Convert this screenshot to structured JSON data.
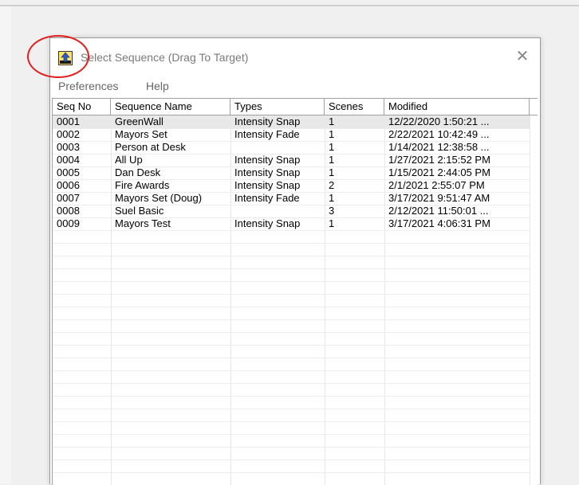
{
  "window": {
    "title": "Select Sequence (Drag To Target)",
    "icon": "sequence-app-icon",
    "close_glyph": "✕"
  },
  "menu": {
    "items": [
      {
        "label": "Preferences"
      },
      {
        "label": "Help"
      }
    ]
  },
  "table": {
    "columns": [
      "Seq No",
      "Sequence Name",
      "Types",
      "Scenes",
      "Modified"
    ],
    "rows": [
      {
        "seq": "0001",
        "name": "GreenWall",
        "type": "Intensity Snap",
        "scenes": "1",
        "modified": "12/22/2020 1:50:21 ..."
      },
      {
        "seq": "0002",
        "name": "Mayors Set",
        "type": "Intensity Fade",
        "scenes": "1",
        "modified": "2/22/2021 10:42:49 ..."
      },
      {
        "seq": "0003",
        "name": "Person at Desk",
        "type": "",
        "scenes": "1",
        "modified": "1/14/2021 12:38:58 ..."
      },
      {
        "seq": "0004",
        "name": "All Up",
        "type": "Intensity Snap",
        "scenes": "1",
        "modified": "1/27/2021 2:15:52 PM"
      },
      {
        "seq": "0005",
        "name": "Dan Desk",
        "type": "Intensity Snap",
        "scenes": "1",
        "modified": "1/15/2021 2:44:05 PM"
      },
      {
        "seq": "0006",
        "name": "Fire Awards",
        "type": "Intensity Snap",
        "scenes": "2",
        "modified": "2/1/2021 2:55:07 PM"
      },
      {
        "seq": "0007",
        "name": "Mayors Set (Doug)",
        "type": "Intensity Fade",
        "scenes": "1",
        "modified": "3/17/2021 9:51:47 AM"
      },
      {
        "seq": "0008",
        "name": "Suel Basic",
        "type": "",
        "scenes": "3",
        "modified": "2/12/2021 11:50:01 ..."
      },
      {
        "seq": "0009",
        "name": "Mayors Test",
        "type": "Intensity Snap",
        "scenes": "1",
        "modified": "3/17/2021 4:06:31 PM"
      }
    ]
  },
  "colors": {
    "annotation": "#e02020",
    "selected_row": "#e8e8e8"
  }
}
